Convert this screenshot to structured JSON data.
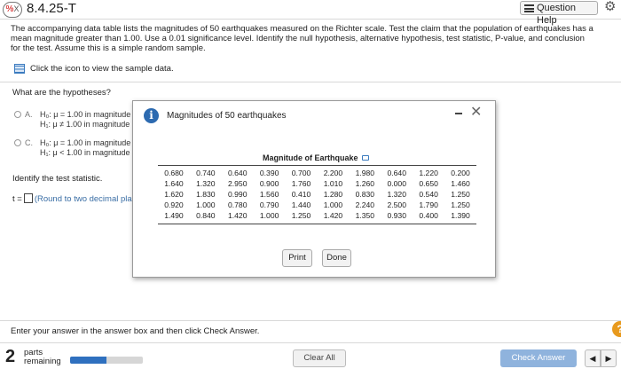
{
  "header": {
    "problem_icon": "%",
    "problem_icon_sub": "X",
    "problem_id": "8.4.25-T",
    "help_label": "Question Help"
  },
  "statement": "The accompanying data table lists the magnitudes of 50 earthquakes measured on the Richter scale. Test the claim that the population of earthquakes has a mean magnitude greater than 1.00. Use a 0.01 significance level. Identify the null hypothesis, alternative hypothesis, test statistic, P-value, and conclusion for the test. Assume this is a simple random sample.",
  "data_link": "Click the icon to view the sample data.",
  "hypotheses_question": "What are the hypotheses?",
  "options": [
    {
      "letter": "A.",
      "line1": "H₀: μ = 1.00 in magnitude",
      "line2": "H₁: μ ≠ 1.00 in magnitude"
    },
    {
      "letter": "C.",
      "line1": "H₀: μ = 1.00 in magnitude",
      "line2": "H₁: μ < 1.00 in magnitude"
    }
  ],
  "identify_label": "Identify the test statistic.",
  "tstat": {
    "prefix": "t =",
    "note": "(Round to two decimal pla"
  },
  "modal": {
    "title": "Magnitudes of 50 earthquakes",
    "close": "✕",
    "table_title": "Magnitude of Earthquake",
    "rows": [
      [
        "0.680",
        "0.740",
        "0.640",
        "0.390",
        "0.700",
        "2.200",
        "1.980",
        "0.640",
        "1.220",
        "0.200"
      ],
      [
        "1.640",
        "1.320",
        "2.950",
        "0.900",
        "1.760",
        "1.010",
        "1.260",
        "0.000",
        "0.650",
        "1.460"
      ],
      [
        "1.620",
        "1.830",
        "0.990",
        "1.560",
        "0.410",
        "1.280",
        "0.830",
        "1.320",
        "0.540",
        "1.250"
      ],
      [
        "0.920",
        "1.000",
        "0.780",
        "0.790",
        "1.440",
        "1.000",
        "2.240",
        "2.500",
        "1.790",
        "1.250"
      ],
      [
        "1.490",
        "0.840",
        "1.420",
        "1.000",
        "1.250",
        "1.420",
        "1.350",
        "0.930",
        "0.400",
        "1.390"
      ]
    ],
    "print_label": "Print",
    "done_label": "Done"
  },
  "footer": {
    "instruction": "Enter your answer in the answer box and then click Check Answer.",
    "help_icon": "?",
    "parts_count": "2",
    "parts_label": "parts",
    "remaining_label": "remaining",
    "progress_fraction": 0.5,
    "clear_label": "Clear All",
    "check_label": "Check Answer",
    "prev": "◀",
    "next": "▶"
  },
  "colors": {
    "accent": "#2f70bf",
    "check_button": "#8fb3dd",
    "help_icon": "#e89a1e",
    "note_text": "#3a6ea5"
  }
}
